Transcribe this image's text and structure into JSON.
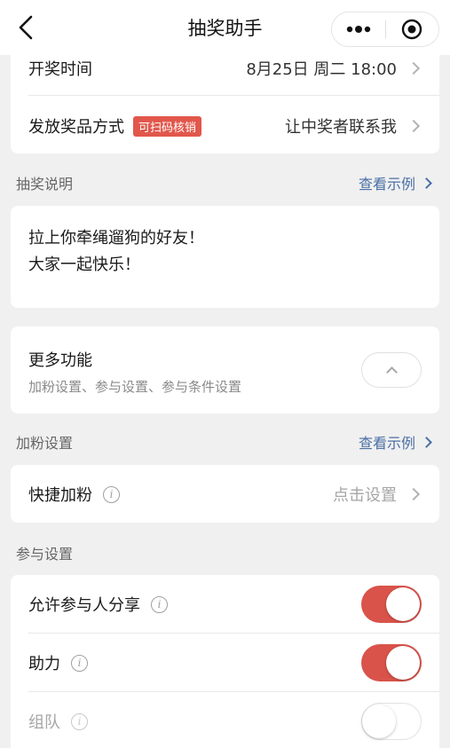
{
  "navbar": {
    "title": "抽奖助手"
  },
  "draw_info": {
    "open_time_label": "开奖时间",
    "open_time_value": "8月25日 周二 18:00",
    "prize_method_label": "发放奖品方式",
    "prize_method_badge": "可扫码核销",
    "prize_method_value": "让中奖者联系我"
  },
  "lottery_desc": {
    "section_title": "抽奖说明",
    "example_link": "查看示例",
    "line1": "拉上你牵绳遛狗的好友！",
    "line2": "大家一起快乐！"
  },
  "more_features": {
    "title": "更多功能",
    "subtitle": "加粉设置、参与设置、参与条件设置"
  },
  "fan_settings": {
    "section_title": "加粉设置",
    "example_link": "查看示例",
    "quick_add_label": "快捷加粉",
    "quick_add_value": "点击设置"
  },
  "participation": {
    "section_title": "参与设置",
    "items": [
      {
        "label": "允许参与人分享",
        "enabled": true
      },
      {
        "label": "助力",
        "enabled": true
      },
      {
        "label": "组队",
        "enabled": false
      }
    ]
  },
  "colors": {
    "accent_red": "#d9534a",
    "link_blue": "#4a6fa5",
    "background": "#f0f0f0"
  }
}
